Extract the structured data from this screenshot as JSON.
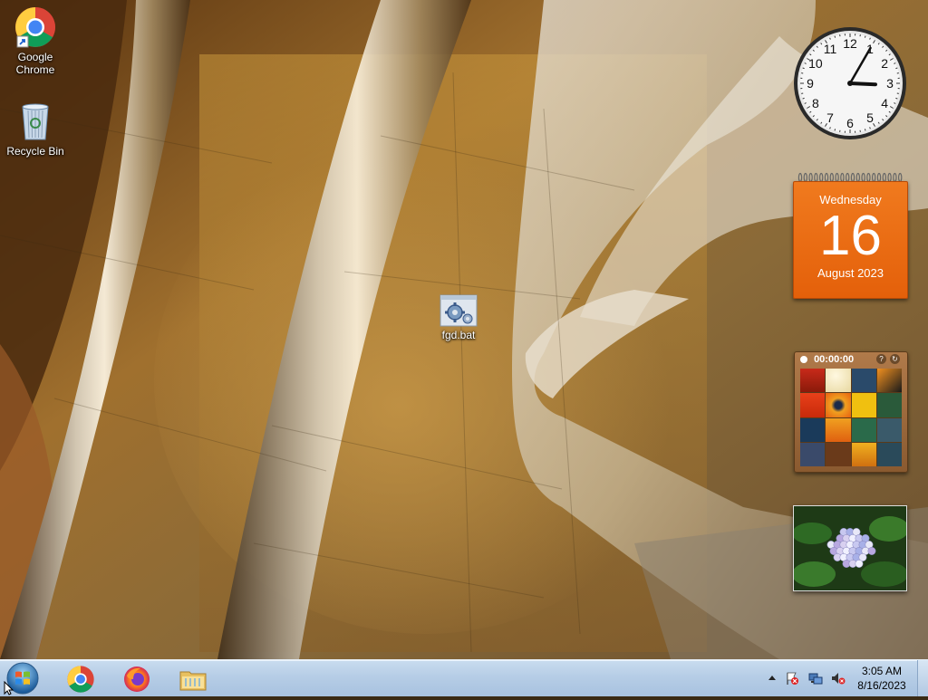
{
  "desktop": {
    "icons": [
      {
        "label": "Google Chrome",
        "icon": "chrome-icon"
      },
      {
        "label": "Recycle Bin",
        "icon": "recycle-bin-icon"
      },
      {
        "label": "fgd.bat",
        "icon": "batch-file-icon"
      }
    ]
  },
  "gadgets": {
    "clock": {
      "hour": 3,
      "minute": 5,
      "numerals": [
        "12",
        "1",
        "2",
        "3",
        "4",
        "5",
        "6",
        "7",
        "8",
        "9",
        "10",
        "11"
      ]
    },
    "calendar": {
      "weekday": "Wednesday",
      "day": "16",
      "month_year": "August 2023",
      "color": "#e8660e"
    },
    "puzzle": {
      "timer": "00:00:00"
    },
    "slideshow": {
      "subject": "hydrangea-photo"
    }
  },
  "taskbar": {
    "pinned": [
      {
        "name": "Google Chrome",
        "icon": "chrome-icon"
      },
      {
        "name": "Firefox",
        "icon": "firefox-icon"
      },
      {
        "name": "Windows Explorer",
        "icon": "folder-icon"
      }
    ],
    "tray": {
      "time": "3:05 AM",
      "date": "8/16/2023",
      "icons": [
        "show-hidden-icons-arrow",
        "action-center-flag-icon",
        "network-icon",
        "volume-muted-icon"
      ]
    }
  }
}
